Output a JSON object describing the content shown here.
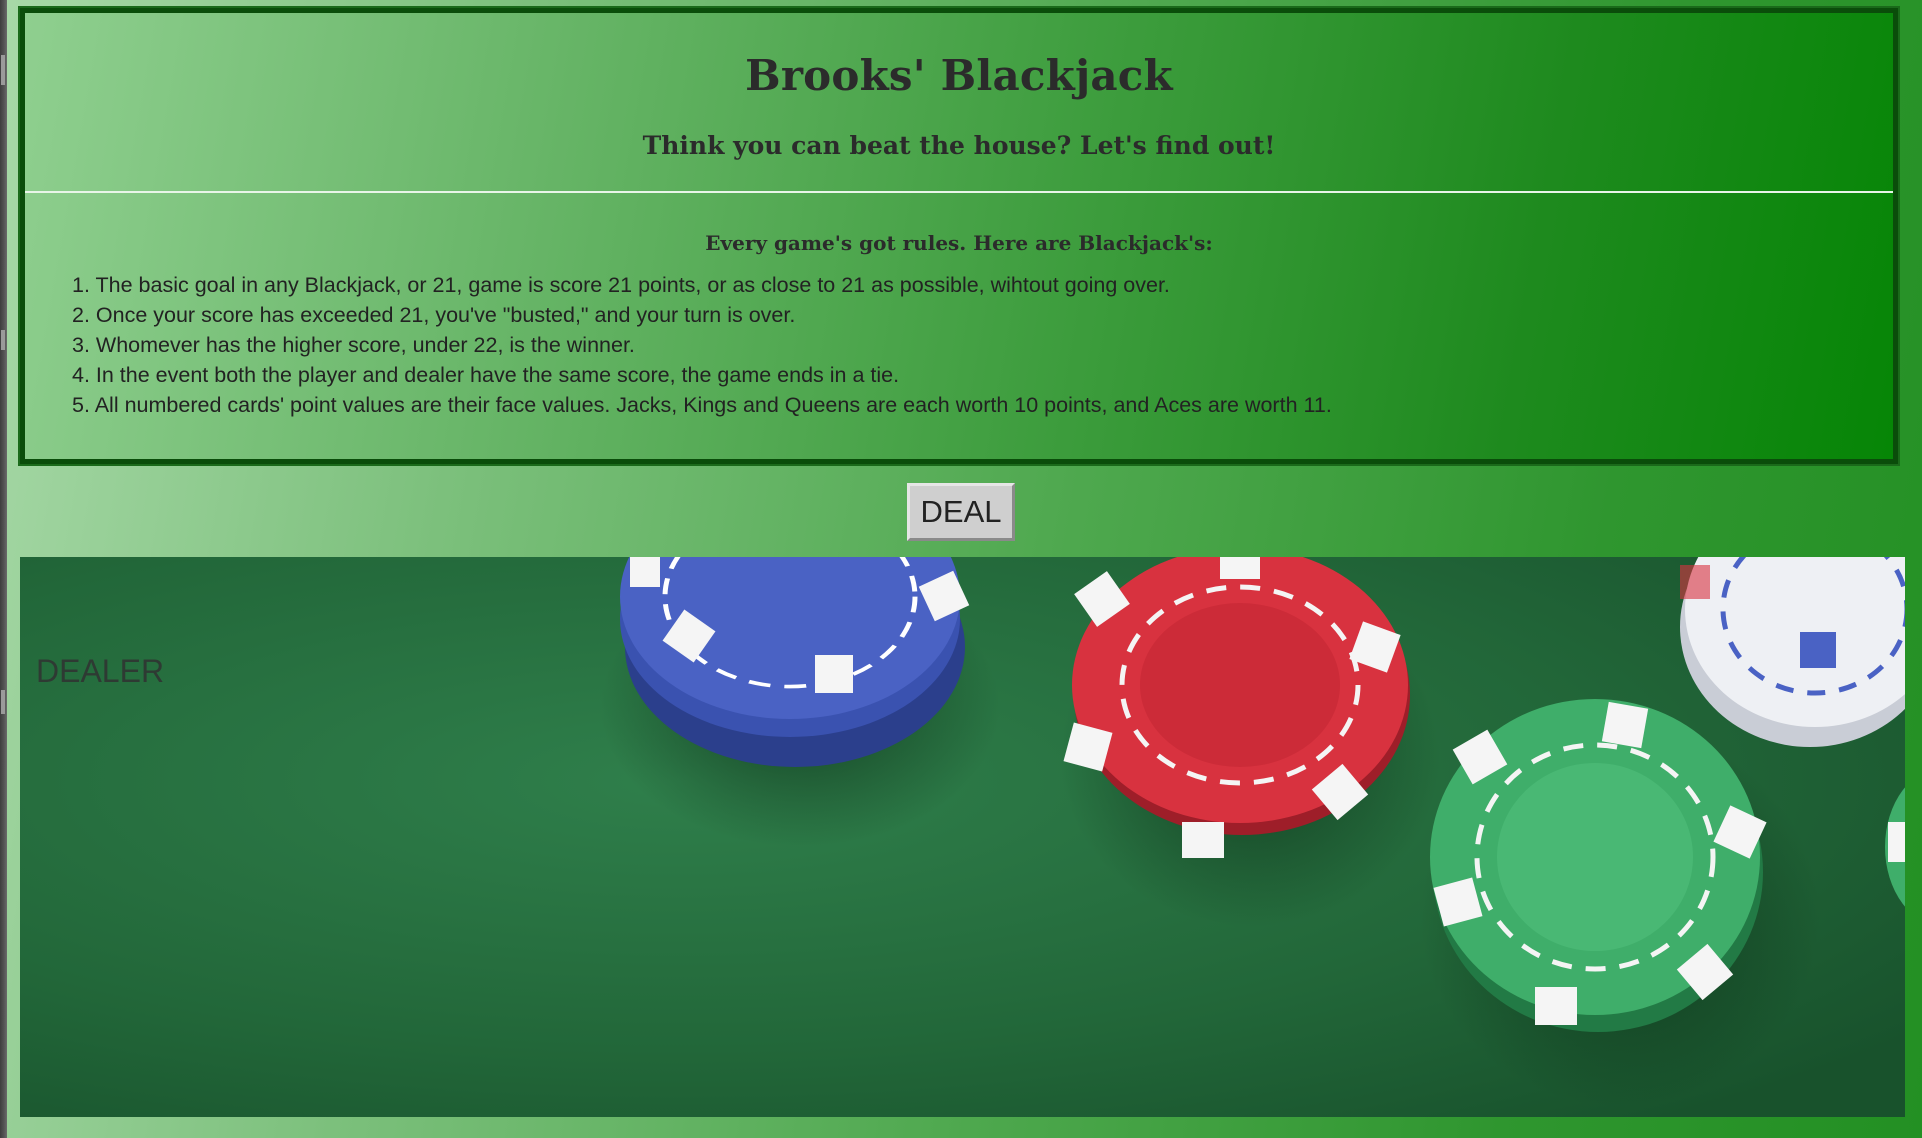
{
  "header": {
    "title": "Brooks' Blackjack",
    "subtitle": "Think you can beat the house? Let's find out!"
  },
  "rules": {
    "heading": "Every game's got rules. Here are Blackjack's:",
    "items": [
      "1. The basic goal in any Blackjack, or 21, game is score 21 points, or as close to 21 as possible, wihtout going over.",
      "2. Once your score has exceeded 21, you've \"busted,\" and your turn is over.",
      "3. Whomever has the higher score, under 22, is the winner.",
      "4. In the event both the player and dealer have the same score, the game ends in a tie.",
      "5. All numbered cards' point values are their face values. Jacks, Kings and Queens are each worth 10 points, and Aces are worth 11."
    ]
  },
  "controls": {
    "deal_label": "DEAL"
  },
  "table": {
    "dealer_label": "DEALER",
    "chip_colors": {
      "blue": "#4a62c4",
      "red": "#d8323f",
      "green": "#3fae6a",
      "white": "#eef0f4"
    }
  }
}
